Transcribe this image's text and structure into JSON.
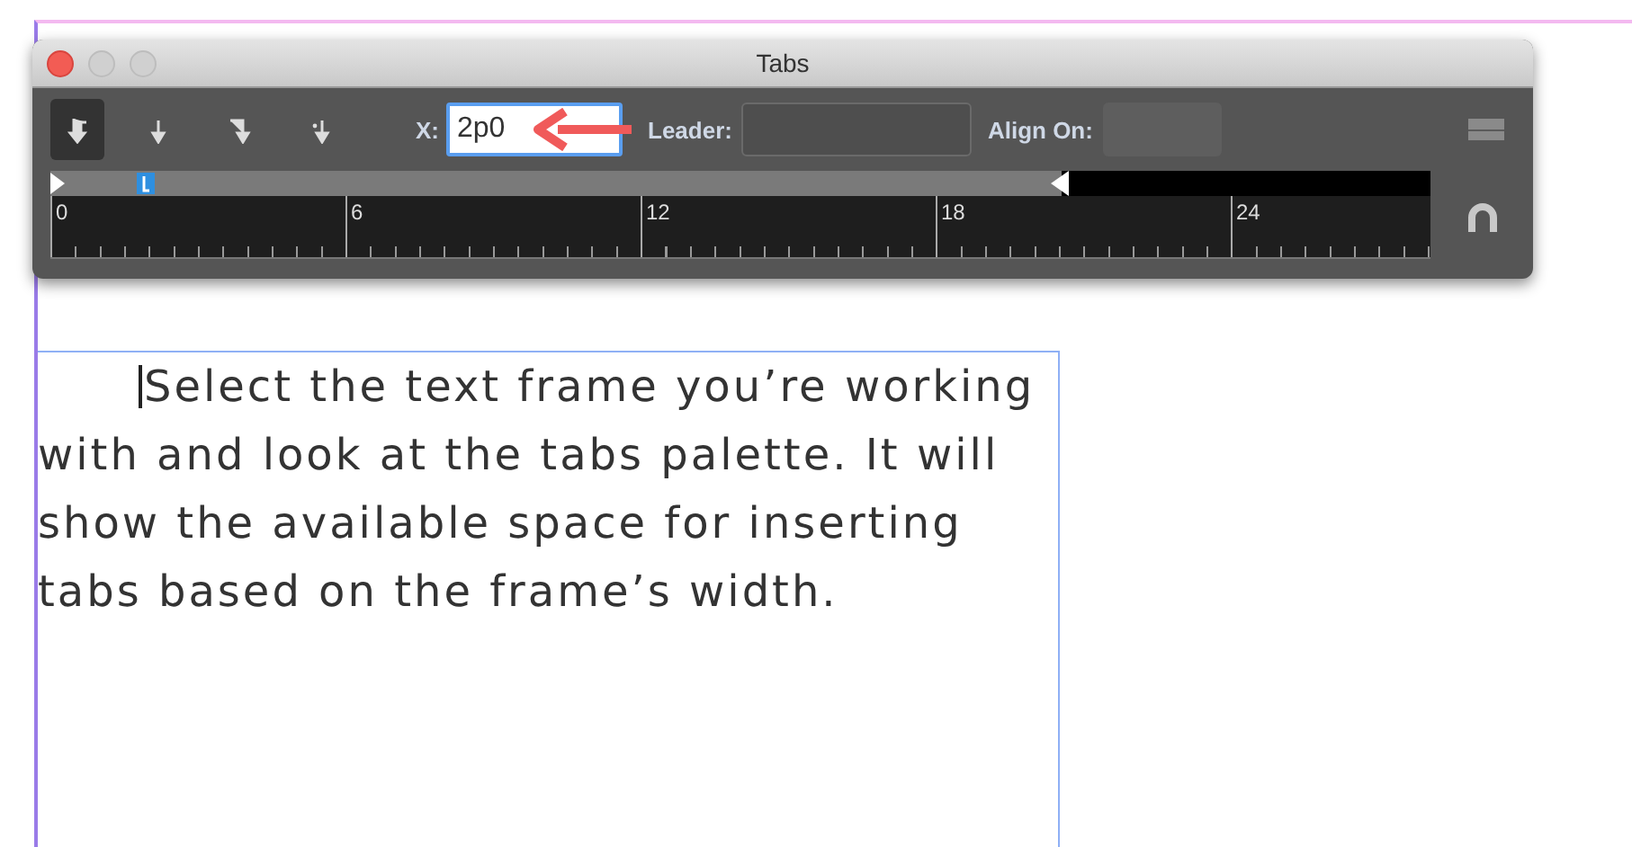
{
  "window": {
    "title": "Tabs"
  },
  "tab_alignment_buttons": [
    {
      "kind": "left",
      "selected": true
    },
    {
      "kind": "center",
      "selected": false
    },
    {
      "kind": "right",
      "selected": false
    },
    {
      "kind": "decimal",
      "selected": false
    }
  ],
  "x_field": {
    "label": "X:",
    "value": "2p0"
  },
  "leader_field": {
    "label": "Leader:"
  },
  "align_on_field": {
    "label": "Align On:"
  },
  "ruler": {
    "labels": [
      "0",
      "6",
      "12",
      "18",
      "24"
    ]
  },
  "text_frame": {
    "text": "Select the text frame you’re working with and look at the tabs palette. It will show the available space for inserting tabs based on the frame’s width."
  }
}
